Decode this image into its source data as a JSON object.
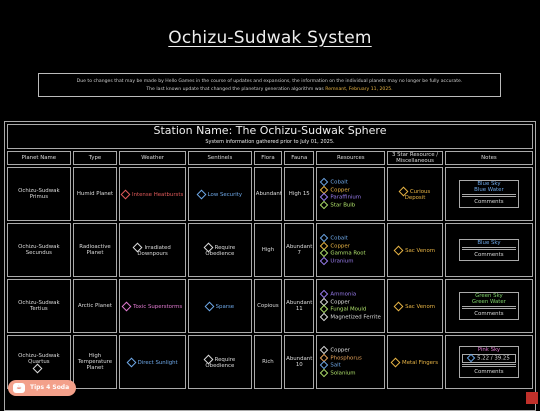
{
  "page_title": "Ochizu-Sudwak System",
  "notice": {
    "line1": "Due to changes that may be made by Hello Games in the course of updates and expansions, the information on the individual planets may no longer be fully accurate.",
    "line2_prefix": "The last known update that changed the planetary generation algorithm was",
    "line2_highlight": "Remnant, February 11, 2025."
  },
  "station": {
    "title": "Station Name: The Ochizu-Sudwak Sphere",
    "subtitle": "System information gathered prior to July 01, 2025."
  },
  "columns": [
    "Planet Name",
    "Type",
    "Weather",
    "Sentinels",
    "Flora",
    "Fauna",
    "Resources",
    "3 Star Resource / Miscellaneous",
    "Notes"
  ],
  "rows": [
    {
      "planet": "Ochizu-Sudwak Primus",
      "type": "Humid Planet",
      "weather": "Intense Heatbursts",
      "weather_color": "#e05a5a",
      "sentinels": "Low Security",
      "sentinels_color": "#6ea8e8",
      "flora": "Abundant",
      "fauna": "High 15",
      "resources": [
        {
          "name": "Cobalt",
          "color": "#6ea8e8"
        },
        {
          "name": "Copper",
          "color": "#e8b444"
        },
        {
          "name": "Paraffinium",
          "color": "#9b7ef0"
        },
        {
          "name": "Star Bulb",
          "color": "#aee06a"
        }
      ],
      "misc": "Curious Deposit",
      "misc_color": "#e8b444",
      "notes_top": "Blue Sky\nBlue Water",
      "notes_color": "#6ea8e8",
      "notes_label": "Comments"
    },
    {
      "planet": "Ochizu-Sudwak Secundus",
      "type": "Radioactive Planet",
      "weather": "Irradiated Downpours",
      "weather_color": "#dddddd",
      "sentinels": "Require Obedience",
      "sentinels_color": "#dddddd",
      "flora": "High",
      "fauna": "Abundant 7",
      "resources": [
        {
          "name": "Cobalt",
          "color": "#6ea8e8"
        },
        {
          "name": "Copper",
          "color": "#e8b444"
        },
        {
          "name": "Gamma Root",
          "color": "#aee06a"
        },
        {
          "name": "Uranium",
          "color": "#9b7ef0"
        }
      ],
      "misc": "Sac Venom",
      "misc_color": "#e8b444",
      "notes_top": "Blue Sky",
      "notes_color": "#6ea8e8",
      "notes_label": "Comments"
    },
    {
      "planet": "Ochizu-Sudwak Tertius",
      "type": "Arctic Planet",
      "weather": "Toxic Superstorms",
      "weather_color": "#e07ad0",
      "sentinels": "Sparse",
      "sentinels_color": "#6ea8e8",
      "flora": "Copious",
      "fauna": "Abundant 11",
      "resources": [
        {
          "name": "Ammonia",
          "color": "#9b7ef0"
        },
        {
          "name": "Copper",
          "color": "#dddddd"
        },
        {
          "name": "Fungal Mould",
          "color": "#aee06a"
        },
        {
          "name": "Magnetized Ferrite",
          "color": "#dddddd"
        }
      ],
      "misc": "Sac Venom",
      "misc_color": "#e8b444",
      "notes_top": "Green Sky\nGreen Water",
      "notes_color": "#7fd36a",
      "notes_label": "Comments"
    },
    {
      "planet": "Ochizu-Sudwak Quartus",
      "type": "High Temperature Planet",
      "weather": "Direct Sunlight",
      "weather_color": "#6ea8e8",
      "sentinels": "Require Obedience",
      "sentinels_color": "#dddddd",
      "flora": "Rich",
      "fauna": "Abundant 10",
      "resources": [
        {
          "name": "Copper",
          "color": "#dddddd"
        },
        {
          "name": "Phosphorus",
          "color": "#e8a45a"
        },
        {
          "name": "Salt",
          "color": "#6ea8e8"
        },
        {
          "name": "Solanium",
          "color": "#aee06a"
        }
      ],
      "misc": "Metal Fingers",
      "misc_color": "#e8b444",
      "notes_top": "Pink Sky",
      "notes_color": "#e07ad0",
      "notes_label": "Comments",
      "coords": "5.22 / 39.25"
    }
  ],
  "tips_badge": "Tips 4 Soda"
}
